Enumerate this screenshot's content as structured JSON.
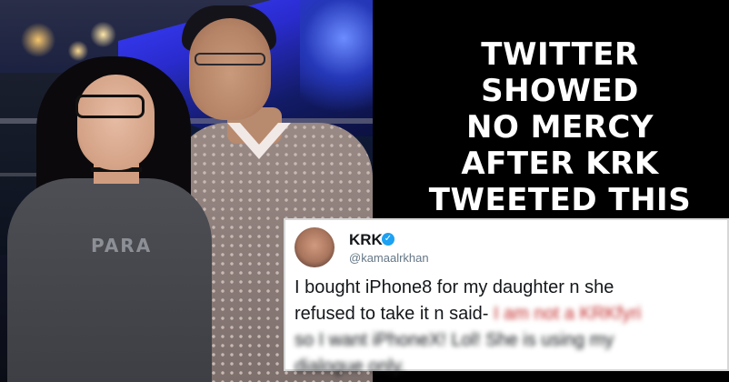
{
  "headline": {
    "lines": [
      "TWITTER",
      "SHOWED",
      "NO MERCY",
      "AFTER KRK",
      "TWEETED THIS"
    ]
  },
  "photo": {
    "shirt_print": "PARA"
  },
  "tweet": {
    "name": "KRK",
    "handle": "@kamaalrkhan",
    "verified_icon": "verified-check-icon",
    "text_line1": "I bought iPhone8 for my daughter n she",
    "text_line2": "refused to take it n said-",
    "text_blurred_line2": "I am not a KRKfyri",
    "text_blurred_line3": "so I want iPhoneX! Lol! She is using my",
    "text_blurred_line4": "dialogue only."
  },
  "colors": {
    "background": "#000000",
    "headline": "#ffffff",
    "verified": "#1da1f2"
  }
}
